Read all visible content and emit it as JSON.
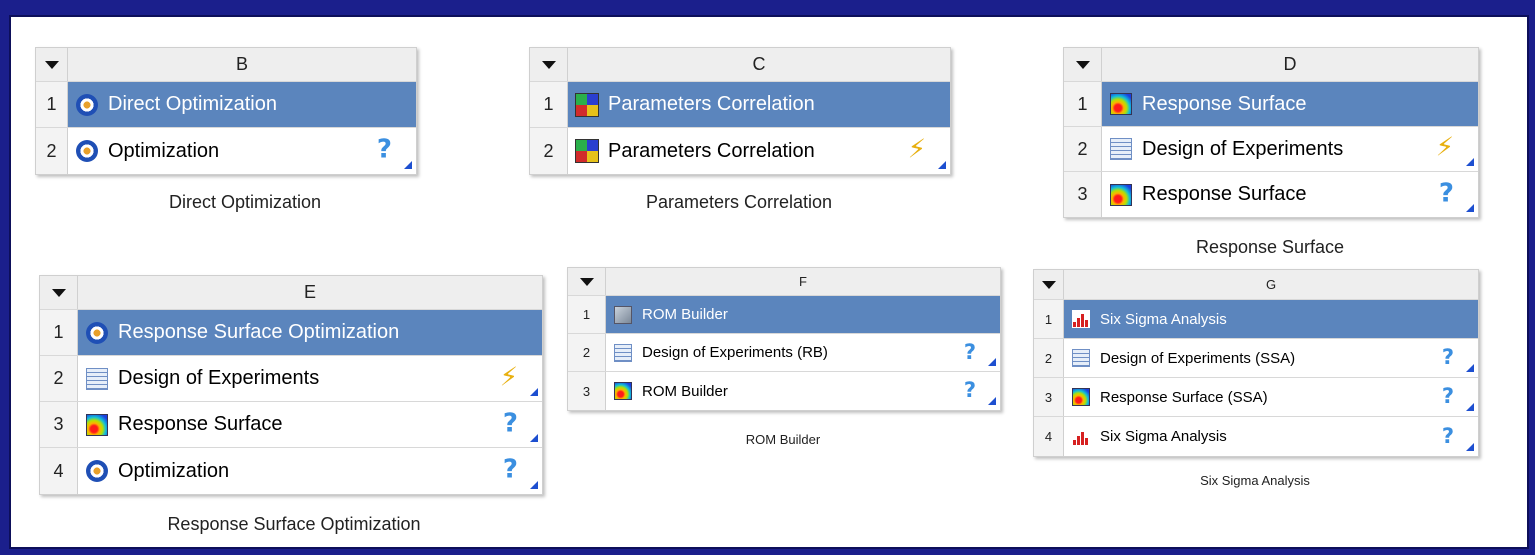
{
  "systems": {
    "B": {
      "letter": "B",
      "caption": "Direct Optimization",
      "rows": [
        {
          "num": "1",
          "label": "Direct Optimization",
          "icon": "target-icon",
          "status": ""
        },
        {
          "num": "2",
          "label": "Optimization",
          "icon": "target-icon",
          "status": "question-icon"
        }
      ]
    },
    "C": {
      "letter": "C",
      "caption": "Parameters Correlation",
      "rows": [
        {
          "num": "1",
          "label": "Parameters Correlation",
          "icon": "correlation-icon",
          "status": ""
        },
        {
          "num": "2",
          "label": "Parameters Correlation",
          "icon": "correlation-icon",
          "status": "lightning-icon"
        }
      ]
    },
    "D": {
      "letter": "D",
      "caption": "Response Surface",
      "rows": [
        {
          "num": "1",
          "label": "Response Surface",
          "icon": "response-surface-icon",
          "status": ""
        },
        {
          "num": "2",
          "label": "Design of Experiments",
          "icon": "doe-table-icon",
          "status": "lightning-icon"
        },
        {
          "num": "3",
          "label": "Response Surface",
          "icon": "response-surface-icon",
          "status": "question-icon"
        }
      ]
    },
    "E": {
      "letter": "E",
      "caption": "Response Surface Optimization",
      "rows": [
        {
          "num": "1",
          "label": "Response Surface Optimization",
          "icon": "target-icon",
          "status": ""
        },
        {
          "num": "2",
          "label": "Design of Experiments",
          "icon": "doe-table-icon",
          "status": "lightning-icon"
        },
        {
          "num": "3",
          "label": "Response Surface",
          "icon": "response-surface-icon",
          "status": "question-icon"
        },
        {
          "num": "4",
          "label": "Optimization",
          "icon": "target-icon",
          "status": "question-icon"
        }
      ]
    },
    "F": {
      "letter": "F",
      "caption": "ROM Builder",
      "rows": [
        {
          "num": "1",
          "label": "ROM Builder",
          "icon": "rom-builder-icon",
          "status": ""
        },
        {
          "num": "2",
          "label": "Design of Experiments (RB)",
          "icon": "doe-table-icon",
          "status": "question-icon"
        },
        {
          "num": "3",
          "label": "ROM Builder",
          "icon": "response-surface-icon",
          "status": "question-icon"
        }
      ]
    },
    "G": {
      "letter": "G",
      "caption": "Six Sigma Analysis",
      "rows": [
        {
          "num": "1",
          "label": "Six Sigma Analysis",
          "icon": "six-sigma-bars-icon",
          "status": ""
        },
        {
          "num": "2",
          "label": "Design of Experiments (SSA)",
          "icon": "doe-table-icon",
          "status": "question-icon"
        },
        {
          "num": "3",
          "label": "Response Surface (SSA)",
          "icon": "response-surface-icon",
          "status": "question-icon"
        },
        {
          "num": "4",
          "label": "Six Sigma Analysis",
          "icon": "six-sigma-bars-icon",
          "status": "question-icon"
        }
      ]
    }
  },
  "glyphs": {
    "question": "?",
    "lightning": "⚡",
    "collapse": "▼"
  },
  "colors": {
    "selected_row": "#5b85bd",
    "background": "#1b1f8c",
    "status_corner": "#1d4fd0"
  }
}
